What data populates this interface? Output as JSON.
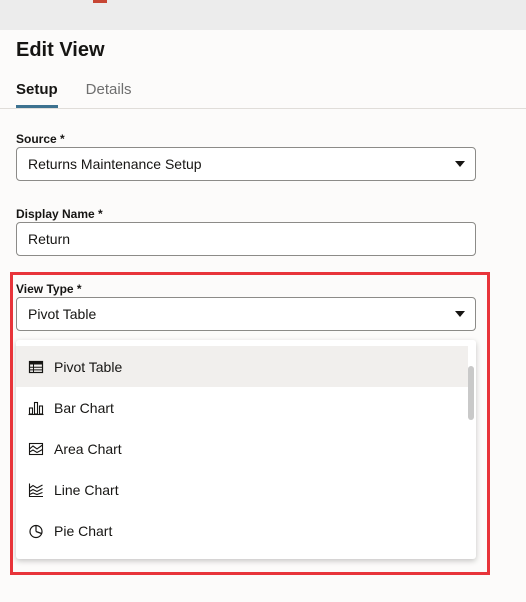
{
  "panel": {
    "title": "Edit View",
    "tabs": [
      {
        "label": "Setup",
        "active": true
      },
      {
        "label": "Details",
        "active": false
      }
    ]
  },
  "form": {
    "source": {
      "label": "Source *",
      "value": "Returns Maintenance Setup"
    },
    "display_name": {
      "label": "Display Name *",
      "value": "Return"
    },
    "view_type": {
      "label": "View Type *",
      "value": "Pivot Table",
      "options": [
        {
          "label": "Pivot Table",
          "icon": "table-icon",
          "selected": true
        },
        {
          "label": "Bar Chart",
          "icon": "bar-chart-icon",
          "selected": false
        },
        {
          "label": "Area Chart",
          "icon": "area-chart-icon",
          "selected": false
        },
        {
          "label": "Line Chart",
          "icon": "line-chart-icon",
          "selected": false
        },
        {
          "label": "Pie Chart",
          "icon": "pie-chart-icon",
          "selected": false
        }
      ]
    }
  },
  "colors": {
    "highlight": "#e8343a",
    "tab_underline": "#3d7290",
    "selected_option_bg": "#f1efed"
  }
}
